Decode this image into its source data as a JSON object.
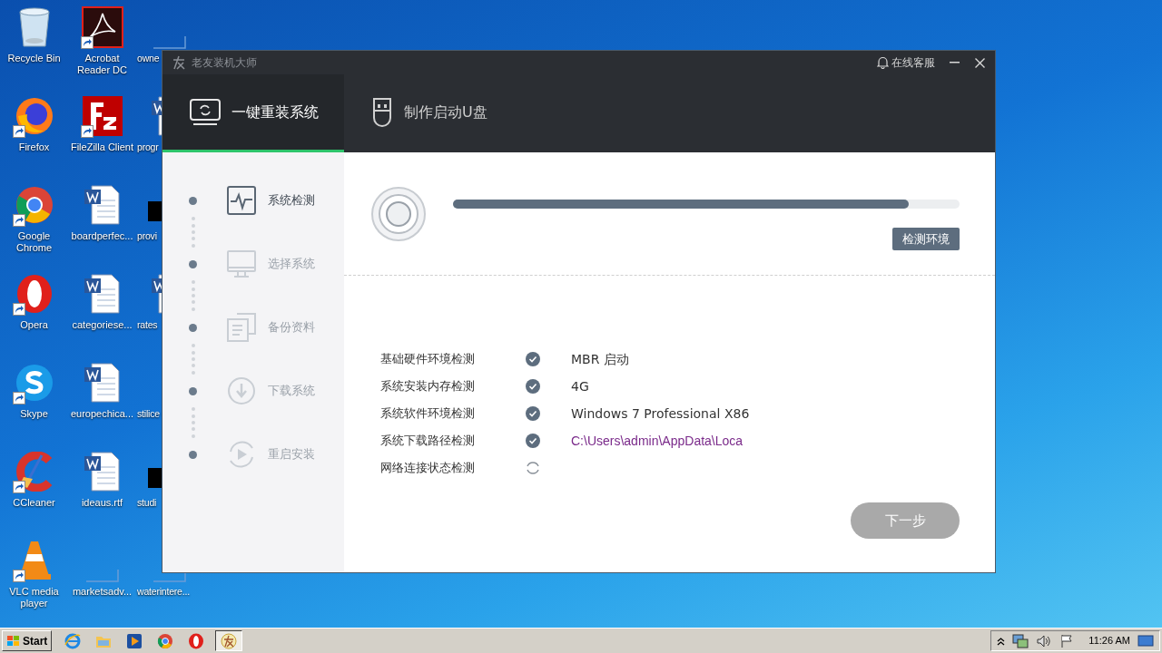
{
  "desktop_icons": [
    {
      "label": "Recycle Bin",
      "kind": "recycle-bin",
      "shortcut": false
    },
    {
      "label": "Firefox",
      "kind": "firefox",
      "shortcut": true
    },
    {
      "label": "Google Chrome",
      "kind": "chrome",
      "shortcut": true
    },
    {
      "label": "Opera",
      "kind": "opera",
      "shortcut": true
    },
    {
      "label": "Skype",
      "kind": "skype",
      "shortcut": true
    },
    {
      "label": "CCleaner",
      "kind": "ccleaner",
      "shortcut": true
    },
    {
      "label": "VLC media player",
      "kind": "vlc",
      "shortcut": true
    },
    {
      "label": "Acrobat Reader DC",
      "kind": "acrobat",
      "shortcut": true
    },
    {
      "label": "FileZilla Client",
      "kind": "filezilla",
      "shortcut": true
    },
    {
      "label": "boardperfec...",
      "kind": "document",
      "shortcut": false
    },
    {
      "label": "categoriese...",
      "kind": "document",
      "shortcut": false
    },
    {
      "label": "europechica...",
      "kind": "document",
      "shortcut": false
    },
    {
      "label": "ideaus.rtf",
      "kind": "document",
      "shortcut": false
    },
    {
      "label": "marketsadv...",
      "kind": "blank",
      "shortcut": false
    },
    {
      "label": "owne",
      "kind": "blank",
      "shortcut": false
    },
    {
      "label": "progr",
      "kind": "document",
      "shortcut": false
    },
    {
      "label": "provi",
      "kind": "black",
      "shortcut": false
    },
    {
      "label": "rates",
      "kind": "document",
      "shortcut": false
    },
    {
      "label": "stilice",
      "kind": "none",
      "shortcut": false
    },
    {
      "label": "studi",
      "kind": "black",
      "shortcut": false
    },
    {
      "label": "waterintere...",
      "kind": "blank",
      "shortcut": false
    }
  ],
  "window": {
    "title": "老友装机大师",
    "support": "在线客服",
    "tabs": [
      {
        "label": "一键重装系统",
        "selected": true
      },
      {
        "label": "制作启动U盘",
        "selected": false
      }
    ],
    "steps": [
      {
        "label": "系统检测",
        "selected": true
      },
      {
        "label": "选择系统",
        "selected": false
      },
      {
        "label": "备份资料",
        "selected": false
      },
      {
        "label": "下载系统",
        "selected": false
      },
      {
        "label": "重启安装",
        "selected": false
      }
    ],
    "progress": {
      "level": 0.9,
      "status": "检测环境"
    },
    "checks": [
      {
        "label": "基础硬件环境检测",
        "done": true,
        "value": "MBR 启动",
        "kind": "text"
      },
      {
        "label": "系统安装内存检测",
        "done": true,
        "value": "4G",
        "kind": "text"
      },
      {
        "label": "系统软件环境检测",
        "done": true,
        "value": "Windows 7 Professional X86",
        "kind": "text"
      },
      {
        "label": "系统下载路径检测",
        "done": true,
        "value": "C:\\Users\\admin\\AppData\\Loca",
        "kind": "path"
      },
      {
        "label": "网络连接状态检测",
        "done": false
      }
    ],
    "next_button": {
      "label": "下一步",
      "disabled": true
    }
  },
  "taskbar": {
    "start": "Start",
    "time": "11:26 AM"
  }
}
